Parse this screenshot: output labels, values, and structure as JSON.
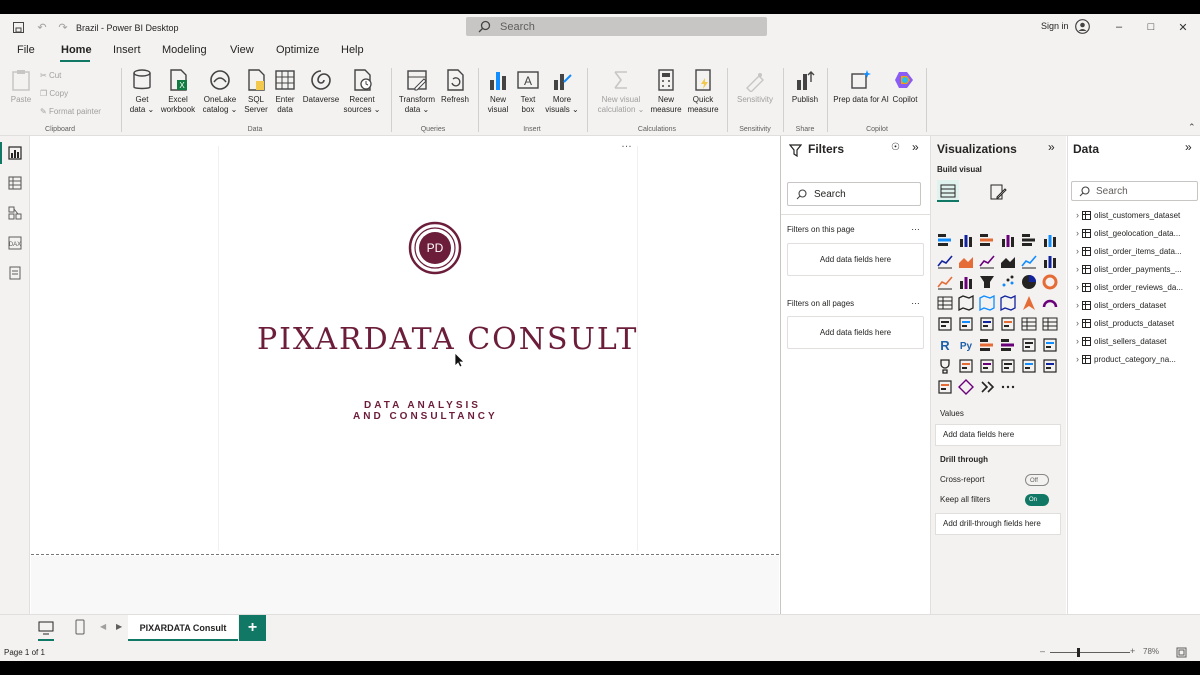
{
  "titlebar": {
    "doc_title": "Brazil - Power BI Desktop",
    "search_placeholder": "Search",
    "signin": "Sign in"
  },
  "menu": [
    "File",
    "Home",
    "Insert",
    "Modeling",
    "View",
    "Optimize",
    "Help"
  ],
  "ribbon": {
    "clipboard": {
      "paste": "Paste",
      "cut": "Cut",
      "copy": "Copy",
      "format_painter": "Format painter",
      "group": "Clipboard"
    },
    "data": {
      "get_data": "Get data ⌄",
      "excel": "Excel workbook",
      "onelake": "OneLake catalog ⌄",
      "sql": "SQL Server",
      "enter": "Enter data",
      "dataverse": "Dataverse",
      "recent": "Recent sources ⌄",
      "group": "Data"
    },
    "queries": {
      "transform": "Transform data ⌄",
      "refresh": "Refresh",
      "group": "Queries"
    },
    "insert": {
      "new_visual": "New visual",
      "text_box": "Text box",
      "more_visuals": "More visuals ⌄",
      "group": "Insert"
    },
    "calculations": {
      "new_visual_calc": "New visual calculation ⌄",
      "new_measure": "New measure",
      "quick_measure": "Quick measure",
      "group": "Calculations"
    },
    "sensitivity": {
      "label": "Sensitivity",
      "group": "Sensitivity"
    },
    "share": {
      "publish": "Publish",
      "group": "Share"
    },
    "copilot": {
      "prep": "Prep data for AI",
      "copilot": "Copilot",
      "group": "Copilot"
    }
  },
  "canvas": {
    "logo_text": "PD",
    "brand": "PIXARDATA CONSULT",
    "tagline1": "DATA ANALYSIS",
    "tagline2": "AND CONSULTANCY",
    "more": "…"
  },
  "tabs": {
    "page_name": "PIXARDATA Consult",
    "add": "+"
  },
  "status": {
    "page_info": "Page 1 of 1",
    "zoom": "78%"
  },
  "filters": {
    "title": "Filters",
    "search": "Search",
    "on_page": "Filters on this page",
    "on_all": "Filters on all pages",
    "add_fields": "Add data fields here"
  },
  "visualizations": {
    "title": "Visualizations",
    "build": "Build visual",
    "values": "Values",
    "add_fields": "Add data fields here",
    "drill": "Drill through",
    "cross_report": "Cross-report",
    "cross_state": "Off",
    "keep_filters": "Keep all filters",
    "keep_state": "On",
    "add_drill": "Add drill-through fields here"
  },
  "data": {
    "title": "Data",
    "search": "Search",
    "tables": [
      "olist_customers_dataset",
      "olist_geolocation_data...",
      "olist_order_items_data...",
      "olist_order_payments_...",
      "olist_order_reviews_da...",
      "olist_orders_dataset",
      "olist_products_dataset",
      "olist_sellers_dataset",
      "product_category_na..."
    ]
  },
  "colors": {
    "accent": "#117865",
    "brand": "#6b1d3a"
  }
}
